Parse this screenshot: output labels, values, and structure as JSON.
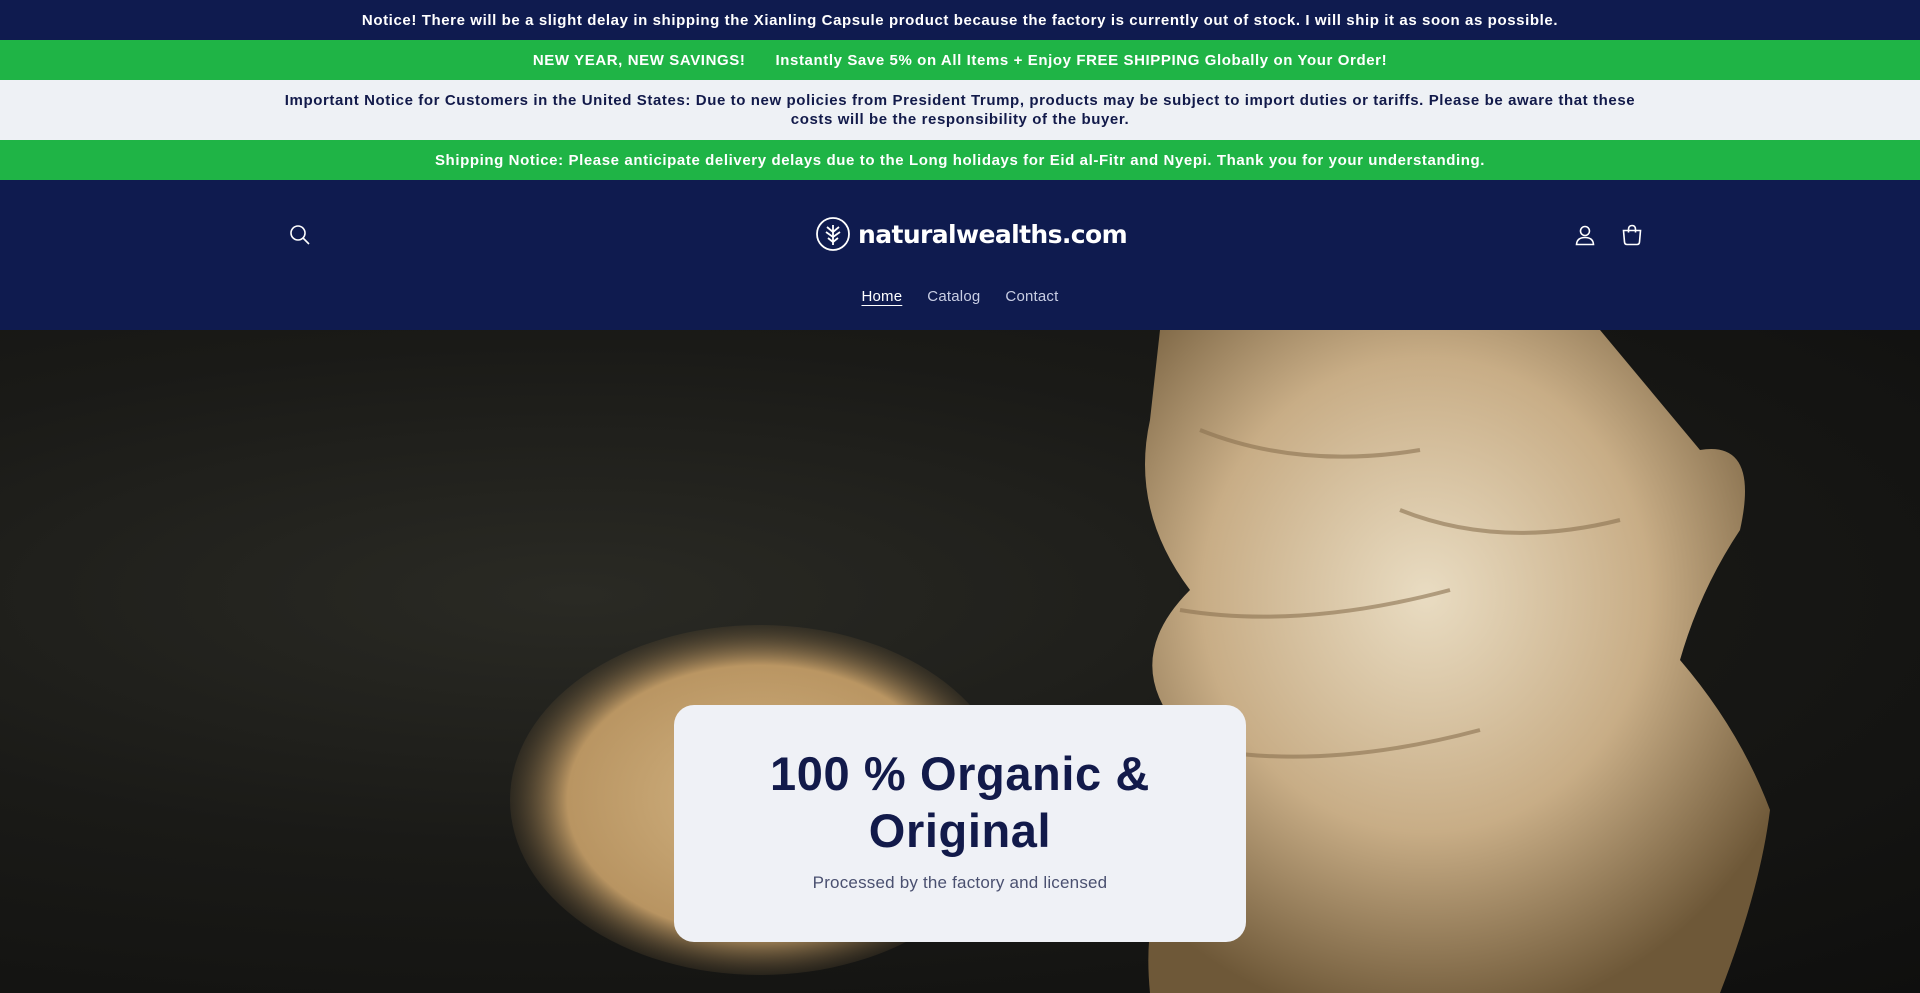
{
  "announcements": {
    "stock_notice": "Notice! There will be a slight delay in shipping the Xianling Capsule product because the factory is currently out of stock. I will ship it as soon as possible.",
    "promo_left": "NEW YEAR, NEW SAVINGS!",
    "promo_right": "Instantly Save 5% on All Items + Enjoy FREE SHIPPING Globally on Your Order!",
    "us_notice": "Important Notice for Customers in the United States: Due to new policies from President Trump, products may be subject to import duties or tariffs. Please be aware that these costs will be the responsibility of the buyer.",
    "shipping_notice": "Shipping Notice: Please anticipate delivery delays due to the Long holidays for Eid al-Fitr and Nyepi. Thank you for your understanding."
  },
  "header": {
    "logo_text": "naturalwealths.com",
    "icons": {
      "search": "search-icon",
      "account": "account-icon",
      "cart": "cart-icon",
      "logo": "tree-logo-icon"
    },
    "nav": [
      {
        "label": "Home",
        "active": true
      },
      {
        "label": "Catalog",
        "active": false
      },
      {
        "label": "Contact",
        "active": false
      }
    ]
  },
  "hero": {
    "title": "100 % Organic & Original",
    "subtitle": "Processed by the factory and licensed",
    "image": "ginger-root-and-powder"
  },
  "colors": {
    "navy": "#0f1b4f",
    "green": "#1fb446",
    "light": "#eef1f5",
    "text_dark": "#121a4a"
  }
}
